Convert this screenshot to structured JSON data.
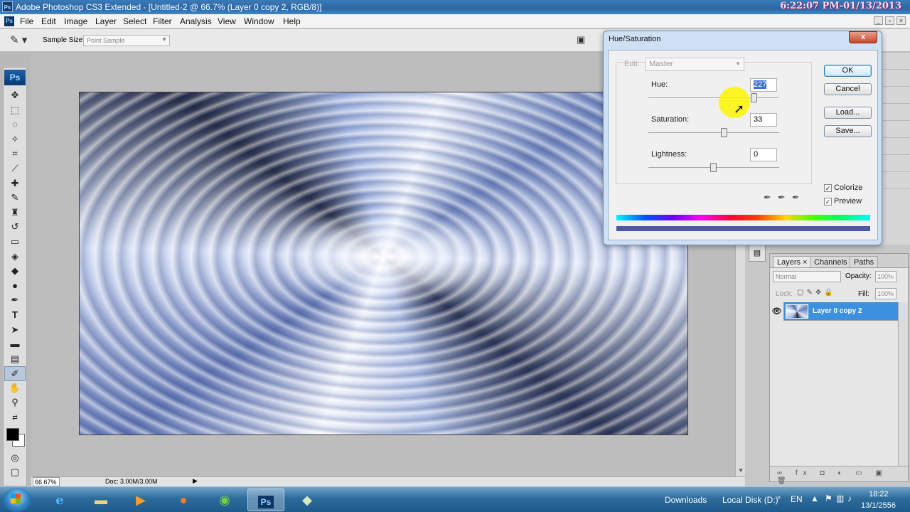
{
  "titlebar": {
    "app_icon": "Ps",
    "title": "Adobe Photoshop CS3 Extended - [Untitled-2 @ 66.7% (Layer 0 copy 2, RGB/8)]",
    "overlay_clock": "6:22:07 PM-01/13/2013"
  },
  "menubar": {
    "items": [
      "File",
      "Edit",
      "Image",
      "Layer",
      "Select",
      "Filter",
      "Analysis",
      "View",
      "Window",
      "Help"
    ]
  },
  "options": {
    "sample_size_label": "Sample Size:",
    "sample_size_value": "Point Sample"
  },
  "toolbox": {
    "logo": "Ps",
    "tools": [
      "move-icon",
      "marquee-icon",
      "lasso-icon",
      "magic-wand-icon",
      "crop-icon",
      "slice-icon",
      "healing-brush-icon",
      "brush-icon",
      "clone-stamp-icon",
      "history-brush-icon",
      "eraser-icon",
      "paint-bucket-icon",
      "blur-icon",
      "dodge-icon",
      "pen-icon",
      "type-icon",
      "path-selection-icon",
      "rectangle-icon",
      "notes-icon",
      "eyedropper-icon",
      "hand-icon",
      "zoom-icon"
    ],
    "active_tool": "eyedropper-icon"
  },
  "status": {
    "zoom": "66.67%",
    "doc_size": "Doc: 3.00M/3.00M"
  },
  "layers_panel": {
    "tabs": [
      "Layers ×",
      "Channels",
      "Paths"
    ],
    "blend_mode": "Normal",
    "opacity_label": "Opacity:",
    "opacity_value": "100%",
    "lock_label": "Lock:",
    "fill_label": "Fill:",
    "fill_value": "100%",
    "layer_name": "Layer 0 copy 2"
  },
  "dialog": {
    "title": "Hue/Saturation",
    "close_label": "x",
    "edit_label": "Edit:",
    "edit_value": "Master",
    "hue_label": "Hue:",
    "hue_value": "227",
    "saturation_label": "Saturation:",
    "saturation_value": "33",
    "lightness_label": "Lightness:",
    "lightness_value": "0",
    "hue_slider_fraction": 0.81,
    "saturation_slider_fraction": 0.58,
    "lightness_slider_fraction": 0.5,
    "buttons": {
      "ok": "OK",
      "cancel": "Cancel",
      "load": "Load...",
      "save": "Save..."
    },
    "colorize_label": "Colorize",
    "colorize_checked": true,
    "preview_label": "Preview",
    "preview_checked": true,
    "result_color": "#4a58a6"
  },
  "taskbar": {
    "apps": [
      "internet-explorer-icon",
      "file-explorer-icon",
      "media-player-icon",
      "firefox-icon",
      "chrome-icon",
      "photoshop-icon",
      "game-icon"
    ],
    "active_app": "photoshop-icon",
    "photoshop_label": "Ps",
    "tray": {
      "downloads": "Downloads",
      "local_disk": "Local Disk (D:)",
      "language": "EN",
      "time": "18:22",
      "date": "13/1/2556"
    }
  }
}
